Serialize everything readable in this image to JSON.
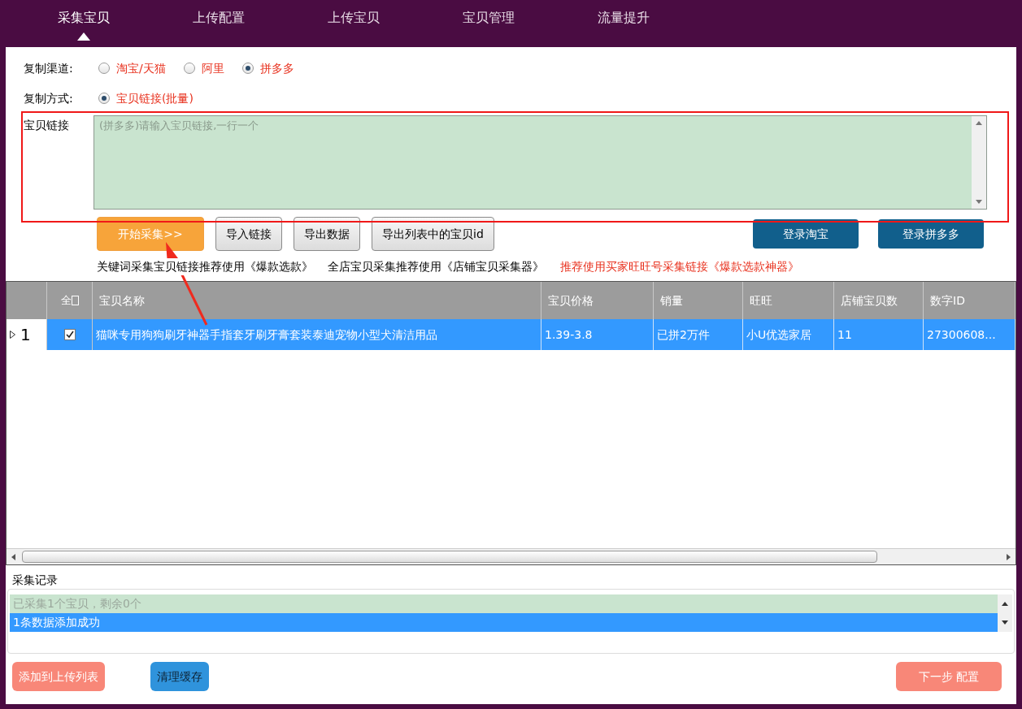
{
  "tabs": [
    {
      "label": "采集宝贝",
      "selected": true
    },
    {
      "label": "上传配置",
      "selected": false
    },
    {
      "label": "上传宝贝",
      "selected": false
    },
    {
      "label": "宝贝管理",
      "selected": false
    },
    {
      "label": "流量提升",
      "selected": false
    }
  ],
  "channel": {
    "label": "复制渠道:",
    "options": [
      {
        "label": "淘宝/天猫",
        "selected": false
      },
      {
        "label": "阿里",
        "selected": false
      },
      {
        "label": "拼多多",
        "selected": true
      }
    ]
  },
  "method": {
    "label": "复制方式:",
    "options": [
      {
        "label": "宝贝链接(批量)",
        "selected": true
      }
    ]
  },
  "link": {
    "label": "宝贝链接",
    "placeholder": "(拼多多)请输入宝贝链接,一行一个"
  },
  "actions": [
    {
      "label": "开始采集>>",
      "kind": "primary"
    },
    {
      "label": "导入链接",
      "kind": "plain"
    },
    {
      "label": "导出数据",
      "kind": "plain"
    },
    {
      "label": "导出列表中的宝贝id",
      "kind": "plain"
    }
  ],
  "logins": [
    "登录淘宝",
    "登录拼多多"
  ],
  "tips": [
    {
      "text": "关键词采集宝贝链接推荐使用《爆款选款》",
      "kind": "normal"
    },
    {
      "text": "全店宝贝采集推荐使用《店铺宝贝采集器》",
      "kind": "normal"
    },
    {
      "text": "推荐使用买家旺旺号采集链接《爆款选款神器》",
      "kind": "alert"
    }
  ],
  "table": {
    "select_all": "全",
    "columns": [
      "宝贝名称",
      "宝贝价格",
      "销量",
      "旺旺",
      "店铺宝贝数",
      "数字ID"
    ],
    "rows": [
      {
        "index": "1",
        "checked": true,
        "selected": true,
        "cells": [
          "猫咪专用狗狗刷牙神器手指套牙刷牙膏套装泰迪宠物小型犬清洁用品",
          "1.39-3.8",
          "已拼2万件",
          "小U优选家居",
          "11",
          "27300608..."
        ]
      }
    ]
  },
  "log": {
    "title": "采集记录",
    "lines": [
      {
        "text": "已采集1个宝贝，剩余0个",
        "selected": false
      },
      {
        "text": "1条数据添加成功",
        "selected": true
      }
    ]
  },
  "footer": [
    {
      "label": "添加到上传列表",
      "kind": "salmon"
    },
    {
      "label": "清理缓存",
      "kind": "blue"
    },
    {
      "label": "下一步 配置",
      "kind": "salmon"
    }
  ]
}
